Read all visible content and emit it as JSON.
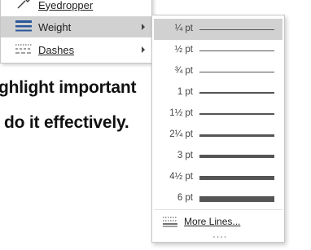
{
  "document": {
    "line1": "ghlight important",
    "line2": "do it effectively."
  },
  "context_menu": {
    "items": [
      {
        "label": "Eyedropper",
        "icon": "eyedropper-icon"
      },
      {
        "label": "Weight",
        "icon": "line-weight-icon",
        "highlighted": true,
        "has_submenu": true
      },
      {
        "label": "Dashes",
        "icon": "dashes-icon",
        "has_submenu": true
      }
    ]
  },
  "weight_submenu": {
    "items": [
      {
        "label": "¼ pt",
        "pt": 0.25,
        "selected": true
      },
      {
        "label": "½ pt",
        "pt": 0.5
      },
      {
        "label": "¾ pt",
        "pt": 0.75
      },
      {
        "label": "1 pt",
        "pt": 1
      },
      {
        "label": "1½ pt",
        "pt": 1.5
      },
      {
        "label": "2¼ pt",
        "pt": 2.25
      },
      {
        "label": "3 pt",
        "pt": 3
      },
      {
        "label": "4½ pt",
        "pt": 4.5
      },
      {
        "label": "6 pt",
        "pt": 6
      }
    ],
    "more_lines_label": "More Lines..."
  },
  "colors": {
    "highlight": "#d1d1d1",
    "weight_icon_accent": "#2b579a",
    "line": "#555555"
  }
}
